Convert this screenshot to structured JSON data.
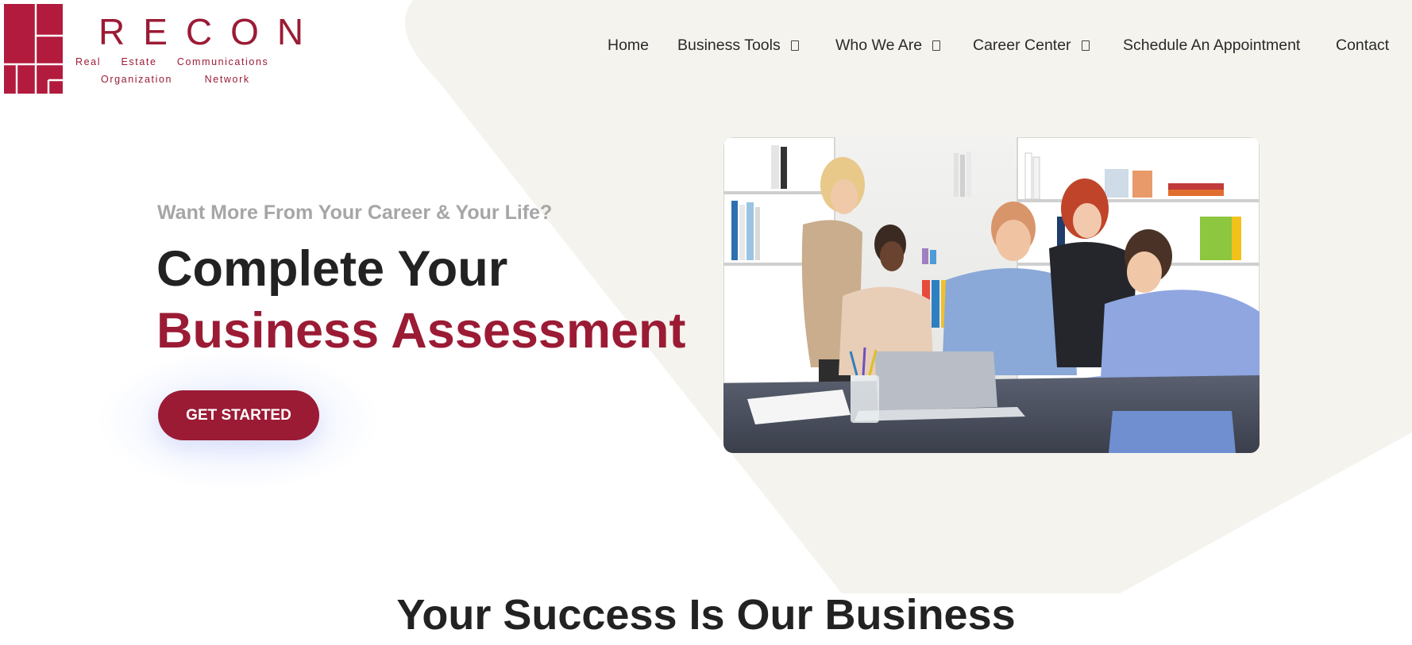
{
  "colors": {
    "brand": "#9b1b35",
    "bg_shape": "#f4f3ee",
    "text_dark": "#222222",
    "kicker_gray": "#a6a6a6"
  },
  "logo": {
    "wordmark": "RECON",
    "line1": "Real     Estate     Communications",
    "line2": "Organization        Network"
  },
  "nav": {
    "items": [
      {
        "label": "Home",
        "has_dropdown": false
      },
      {
        "label": "Business Tools",
        "has_dropdown": true
      },
      {
        "label": "Who We Are",
        "has_dropdown": true
      },
      {
        "label": "Career Center",
        "has_dropdown": true
      },
      {
        "label": "Schedule An Appointment",
        "has_dropdown": false
      },
      {
        "label": "Contact",
        "has_dropdown": false
      }
    ]
  },
  "hero": {
    "kicker": "Want More From Your Career & Your Life?",
    "title_line1": "Complete Your",
    "title_line2": "Business Assessment",
    "cta_label": "GET STARTED",
    "image_alt": "team-meeting-photo"
  },
  "section": {
    "title": "Your Success Is Our Business"
  }
}
